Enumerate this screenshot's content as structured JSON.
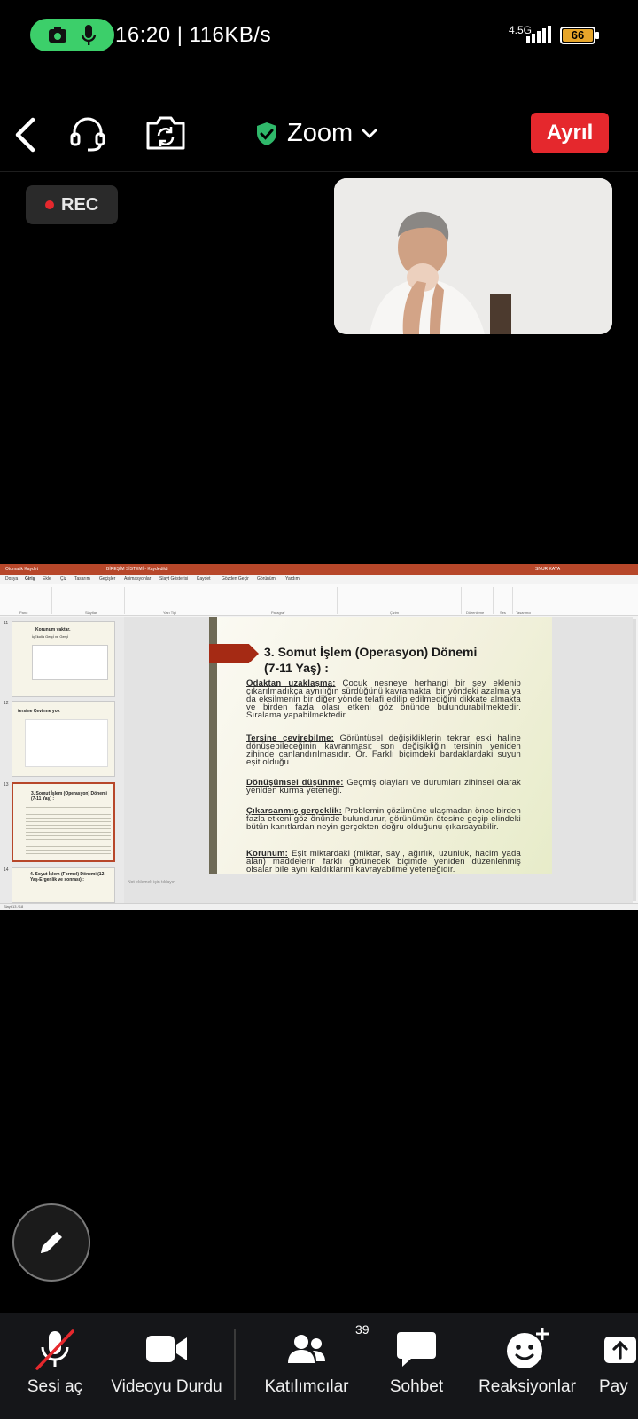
{
  "status_bar": {
    "time_speed": "16:20 | 116KB/s",
    "network_type": "4.5G",
    "battery": "66",
    "colors": {
      "recording_pill": "#3ccf6a",
      "battery_fill": "#e6a52a"
    }
  },
  "toolbar": {
    "meeting_title": "Zoom",
    "leave_label": "Ayrıl",
    "colors": {
      "leave": "#e5282d",
      "secure_shield": "#2fb86a"
    }
  },
  "recording": {
    "label": "REC"
  },
  "shared_screen": {
    "slide": {
      "title_line1": "3. Somut İşlem (Operasyon) Dönemi",
      "title_line2": "(7-11 Yaş) :",
      "paragraphs": [
        {
          "term": "Odaktan uzaklaşma:",
          "text": " Çocuk nesneye herhangi bir şey eklenip çıkarılmadıkça aynılığın sürdüğünü kavramakta, bir yöndeki azalma ya da eksilmenin bir diğer yönde telafi edilip edilmediğini dikkate almakta ve birden fazla olası etkeni göz önünde bulundurabilmektedir. Sıralama yapabilmektedir."
        },
        {
          "term": "Tersine çevirebilme:",
          "text": " Görüntüsel değişikliklerin tekrar eski haline dönüşebileceğinin kavranması; son değişikliğin tersinin yeniden zihinde canlandırılmasıdır. Ör. Farklı biçimdeki bardaklardaki suyun eşit olduğu..."
        },
        {
          "term": "Dönüşümsel düşünme:",
          "text": " Geçmiş olayları ve durumları zihinsel olarak yeniden kurma yeteneği."
        },
        {
          "term": "Çıkarsanmış gerçeklik:",
          "text": " Problemin çözümüne ulaşmadan önce birden fazla etkeni göz önünde bulundurur, görünümün ötesine geçip elindeki bütün kanıtlardan neyin gerçekten doğru olduğunu çıkarsayabilir."
        },
        {
          "term": "Korunum:",
          "text": " Eşit miktardaki (miktar, sayı, ağırlık, uzunluk, hacim yada alan) maddelerin farklı görünecek biçimde yeniden düzenlenmiş olsalar bile aynı kaldıklarını kavrayabilme yeteneğidir."
        }
      ]
    },
    "thumbnails": [
      {
        "num": "11",
        "title": "Korunum vaktar.",
        "subtitle": "İçEkolla Gerçİ ve Gerçİ"
      },
      {
        "num": "12",
        "title": "tersine Çevirme yok"
      },
      {
        "num": "13",
        "title": "3. Somut İşlem (Operasyon) Dönemi (7-11 Yaş) :"
      },
      {
        "num": "14",
        "title": "4. Soyut İşlem (Formel) Dönemi (12 Yaş-Ergenlik ve sonrası) :"
      }
    ],
    "tabs": [
      "Dosya",
      "Giriş",
      "Ekle",
      "Çiz",
      "Tasarım",
      "Geçişler",
      "Animasyonlar",
      "Slayt Gösterisi",
      "Kaydet",
      "Gözden Geçir",
      "Görünüm",
      "Yardım"
    ],
    "ribbon_groups": [
      "Pano",
      "Slaytlar",
      "Yazı Tipi",
      "Paragraf",
      "Çizim",
      "Düzenleme",
      "Ses",
      "Tasarımcı"
    ],
    "notes_placeholder": "Not eklemek için tıklayın",
    "status_text": "Slayt 13 / 18"
  },
  "bottom_bar": {
    "items": [
      {
        "label": "Sesi aç",
        "icon": "mic-muted-icon"
      },
      {
        "label": "Videoyu Durdu",
        "icon": "video-camera-icon"
      },
      {
        "label": "Katılımcılar",
        "icon": "participants-icon",
        "count": "39"
      },
      {
        "label": "Sohbet",
        "icon": "chat-icon"
      },
      {
        "label": "Reaksiyonlar",
        "icon": "reaction-icon"
      },
      {
        "label": "Pay",
        "icon": "share-icon"
      }
    ],
    "colors": {
      "mute_slash": "#e5282d"
    }
  }
}
